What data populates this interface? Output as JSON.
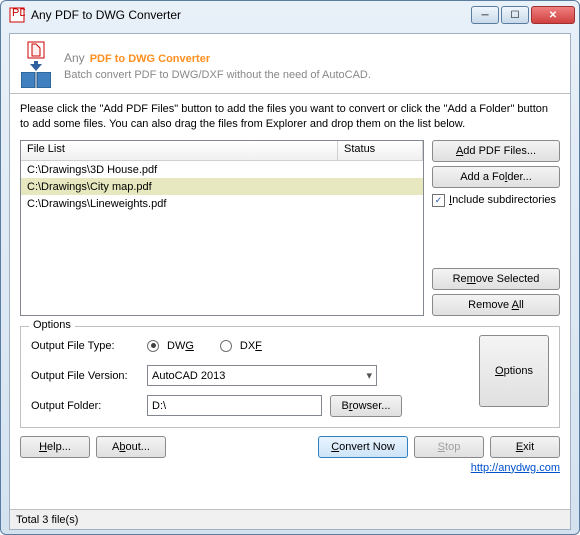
{
  "window": {
    "title": "Any PDF to DWG Converter"
  },
  "header": {
    "any": "Any",
    "main": "PDF to DWG Converter",
    "sub": "Batch convert PDF to DWG/DXF without the need of AutoCAD."
  },
  "instructions": "Please click the \"Add PDF Files\" button to add the files you want to convert or click the \"Add a Folder\" button to add some files. You can also drag the files from Explorer and drop them on the list below.",
  "columns": {
    "file": "File List",
    "status": "Status"
  },
  "files": [
    {
      "path": "C:\\Drawings\\3D House.pdf"
    },
    {
      "path": "C:\\Drawings\\City map.pdf"
    },
    {
      "path": "C:\\Drawings\\Lineweights.pdf"
    }
  ],
  "selected_index": 1,
  "buttons": {
    "add_files": "Add PDF Files...",
    "add_folder": "Add a Folder...",
    "include_sub": "Include subdirectories",
    "remove_selected": "Remove Selected",
    "remove_all": "Remove All",
    "options": "Options",
    "help": "Help...",
    "about": "About...",
    "convert": "Convert Now",
    "stop": "Stop",
    "exit": "Exit",
    "browser": "Browser..."
  },
  "options": {
    "legend": "Options",
    "type_label": "Output File Type:",
    "type_dwg": "DWG",
    "type_dxf": "DXF",
    "type_selected": "DWG",
    "version_label": "Output File Version:",
    "version_value": "AutoCAD 2013",
    "folder_label": "Output Folder:",
    "folder_value": "D:\\"
  },
  "link": "http://anydwg.com",
  "status": "Total 3 file(s)"
}
